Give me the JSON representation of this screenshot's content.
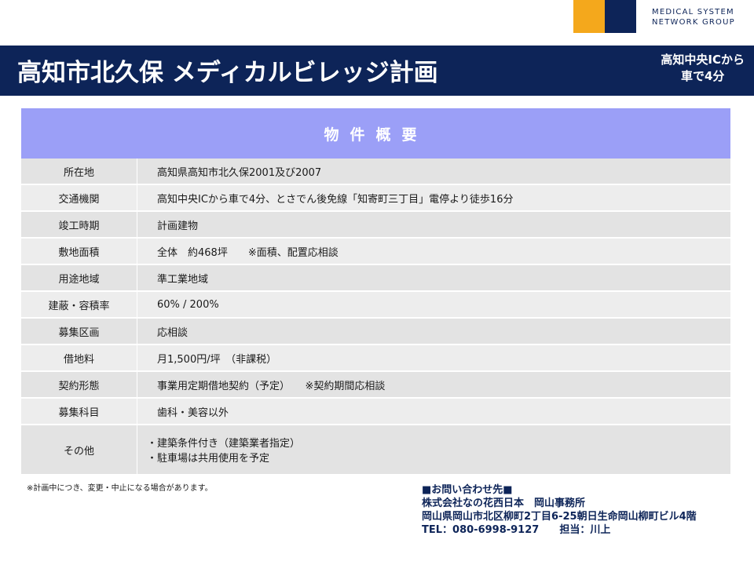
{
  "brand": {
    "logo_line1": "MEDICAL SYSTEM",
    "logo_line2": "NETWORK GROUP",
    "accent_orange": "#f4a81c",
    "accent_navy": "#0d2458"
  },
  "header": {
    "title": "高知市北久保 メディカルビレッジ計画",
    "access_line1": "高知中央ICから",
    "access_line2": "車で4分"
  },
  "table": {
    "heading": "物件概要",
    "rows": [
      {
        "label": "所在地",
        "value": "高知県高知市北久保2001及び2007"
      },
      {
        "label": "交通機関",
        "value": "高知中央ICから車で4分、とさでん後免線「知寄町三丁目」電停より徒歩16分"
      },
      {
        "label": "竣工時期",
        "value": "計画建物"
      },
      {
        "label": "敷地面積",
        "value": "全体　約468坪　　※面積、配置応相談"
      },
      {
        "label": "用途地域",
        "value": "準工業地域"
      },
      {
        "label": "建蔽・容積率",
        "value": "60% / 200%"
      },
      {
        "label": "募集区画",
        "value": "応相談"
      },
      {
        "label": "借地料",
        "value": "月1,500円/坪　（非課税）"
      },
      {
        "label": "契約形態",
        "value": "事業用定期借地契約（予定）　　※契約期間応相談"
      },
      {
        "label": "募集科目",
        "value": "歯科・美容以外"
      },
      {
        "label": "その他",
        "value_line1": "・建築条件付き（建築業者指定）",
        "value_line2": "・駐車場は共用使用を予定"
      }
    ]
  },
  "note": "※計画中につき、変更・中止になる場合があります。",
  "contact": {
    "heading": "■お問い合わせ先■",
    "company": "株式会社なの花西日本　岡山事務所",
    "address": "岡山県岡山市北区柳町2丁目6-25朝日生命岡山柳町ビル4階",
    "tel": "TEL：080-6998-9127　　担当：川上"
  }
}
